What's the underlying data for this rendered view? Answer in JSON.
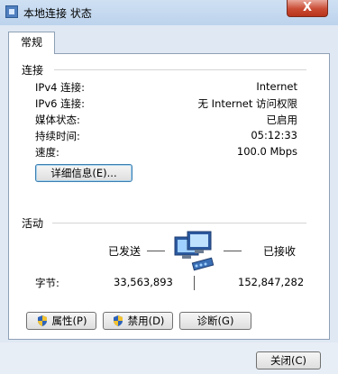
{
  "window": {
    "title": "本地连接 状态",
    "close_glyph": "X"
  },
  "tabs": [
    {
      "label": "常规"
    }
  ],
  "connection": {
    "section_title": "连接",
    "rows": [
      {
        "label": "IPv4 连接:",
        "value": "Internet"
      },
      {
        "label": "IPv6 连接:",
        "value": "无 Internet 访问权限"
      },
      {
        "label": "媒体状态:",
        "value": "已启用"
      },
      {
        "label": "持续时间:",
        "value": "05:12:33"
      },
      {
        "label": "速度:",
        "value": "100.0 Mbps"
      }
    ],
    "details_button": "详细信息(E)..."
  },
  "activity": {
    "section_title": "活动",
    "sent_label": "已发送",
    "received_label": "已接收",
    "bytes_label": "字节:",
    "bytes_sent": "33,563,893",
    "bytes_received": "152,847,282"
  },
  "buttons": {
    "properties": "属性(P)",
    "disable": "禁用(D)",
    "diagnose": "诊断(G)",
    "close": "关闭(C)"
  },
  "icons": {
    "window_icon": "network-adapter-icon",
    "shield": "uac-shield-icon",
    "network": "network-computers-icon"
  }
}
